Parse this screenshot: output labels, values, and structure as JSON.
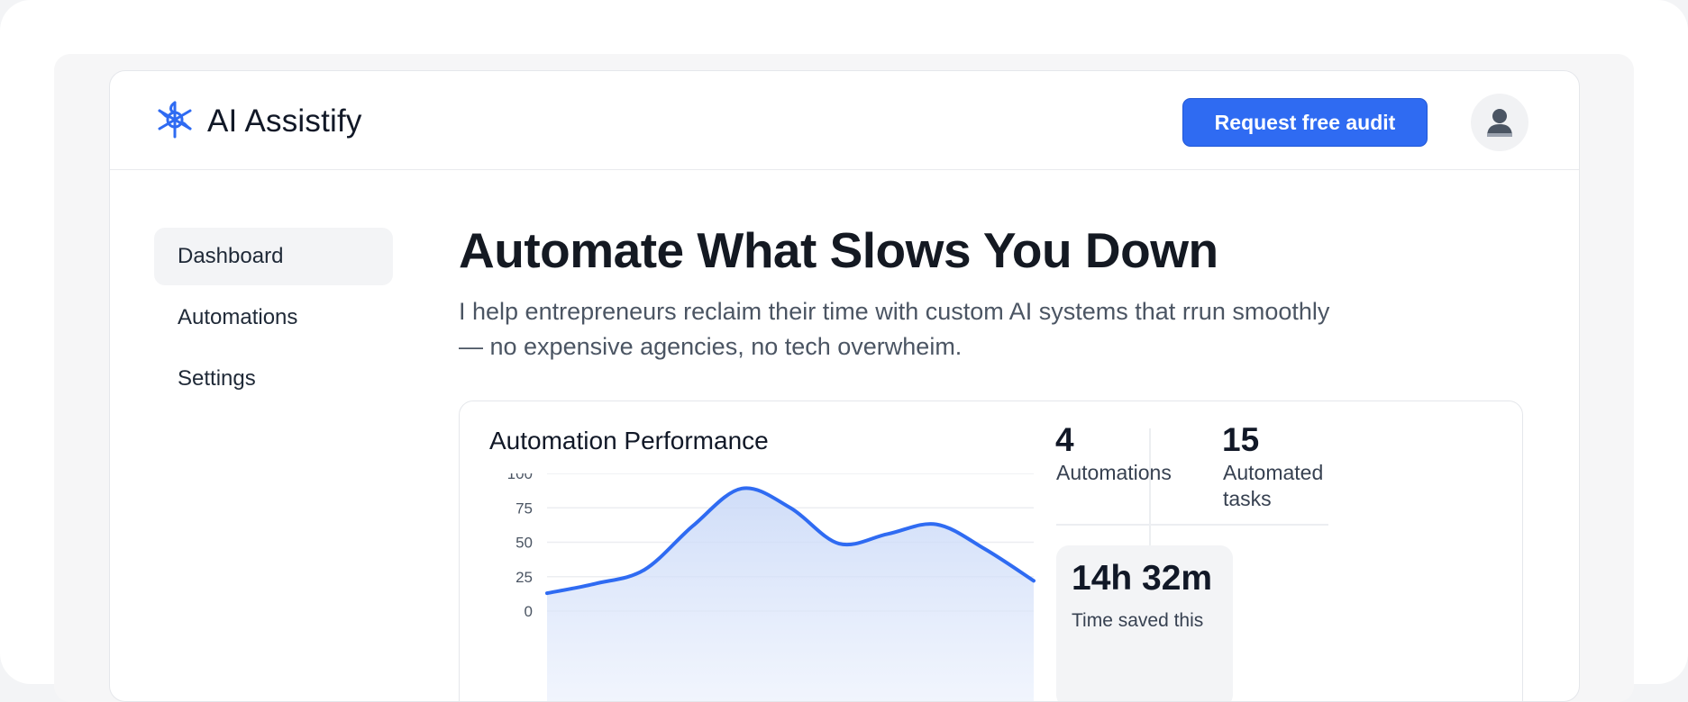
{
  "header": {
    "logo_icon": "sparkle-icon",
    "brand": "AI Assistify",
    "cta_label": "Request free audit",
    "avatar_icon": "user-icon"
  },
  "sidebar": {
    "items": [
      {
        "label": "Dashboard",
        "active": true
      },
      {
        "label": "Automations",
        "active": false
      },
      {
        "label": "Settings",
        "active": false
      }
    ]
  },
  "hero": {
    "title": "Automate What Slows You Down",
    "subtitle": "I help entrepreneurs reclaim their time with custom AI systems that rrun smoothly — no expensive agencies, no tech overwheim."
  },
  "performance_card": {
    "title": "Automation Performance",
    "stats": [
      {
        "value": "4",
        "label": "Automations"
      },
      {
        "value": "15",
        "label": "Automated tasks"
      }
    ],
    "time_saved": {
      "value": "14h 32m",
      "label": "Time saved this"
    }
  },
  "colors": {
    "accent": "#2f6bf2",
    "text": "#111827",
    "muted": "#4b5563"
  },
  "chart_data": {
    "type": "area",
    "title": "Automation Performance",
    "ylim": [
      0,
      100
    ],
    "yticks": [
      "100",
      "75",
      "50",
      "25",
      "0"
    ],
    "grid": true,
    "x": [
      0,
      1,
      2,
      3,
      4,
      5,
      6,
      7,
      8,
      9,
      10
    ],
    "values": [
      13,
      20,
      30,
      62,
      89,
      75,
      49,
      56,
      63,
      45,
      22
    ]
  }
}
